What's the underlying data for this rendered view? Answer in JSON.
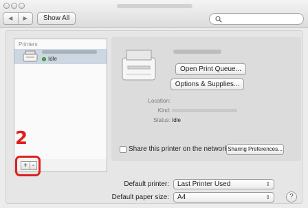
{
  "window": {
    "traffic_lights": [
      "close-icon",
      "minimize-icon",
      "zoom-icon"
    ]
  },
  "toolbar": {
    "back_icon": "◀",
    "forward_icon": "▶",
    "show_all_label": "Show All",
    "search_placeholder": ""
  },
  "sidebar": {
    "header": "Printers",
    "items": [
      {
        "status": "Idle",
        "status_color": "#4caf3f"
      }
    ],
    "add_label": "+",
    "remove_label": "-"
  },
  "annotation": {
    "step_number": "2",
    "highlight_color": "#e01e1e"
  },
  "details": {
    "open_queue_label": "Open Print Queue...",
    "options_supplies_label": "Options & Supplies...",
    "location_label": "Location:",
    "kind_label": "Kind:",
    "status_label": "Status:",
    "status_value": "Idle",
    "share_label": "Share this printer on the network",
    "sharing_prefs_label": "Sharing Preferences..."
  },
  "preferences": {
    "default_printer_label": "Default printer:",
    "default_printer_value": "Last Printer Used",
    "default_paper_label": "Default paper size:",
    "default_paper_value": "A4",
    "popup_arrows": "⇕",
    "help_label": "?"
  }
}
